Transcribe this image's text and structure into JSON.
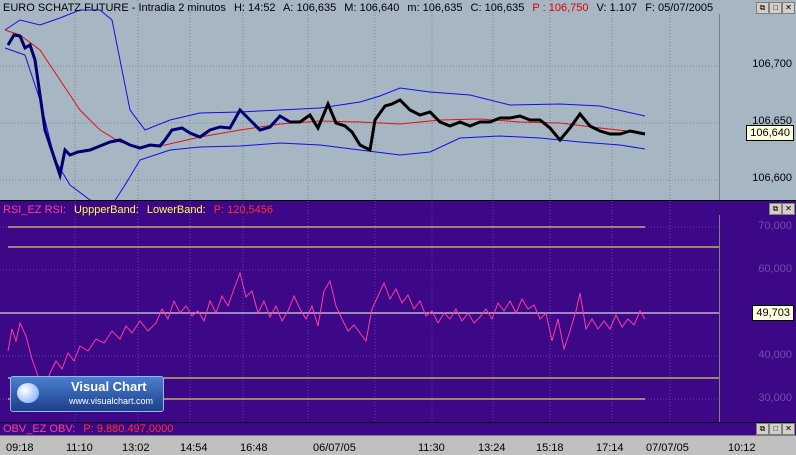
{
  "main": {
    "title": "EURO SCHATZ FUTURE - Intradia 2 minutos",
    "h_label": "H: 14:52",
    "a_label": "A: 106,635",
    "m_label": "M: 106,640",
    "m2_label": "m: 106,635",
    "c_label": "C: 106,635",
    "p_label": "P : 106,750",
    "v_label": "V: 1.107",
    "f_label": "F: 05/07/2005",
    "current_tag": "106,640",
    "y_ticks": [
      "106,700",
      "106,650",
      "106,600"
    ]
  },
  "rsi": {
    "label": "RSI_EZ RSI:",
    "upper_label": "UppperBand:",
    "lower_label": "LowerBand:",
    "p_label": "P: 120,5456",
    "current_tag": "49,703",
    "y_ticks": [
      "70,000",
      "60,000",
      "40,000",
      "30,000"
    ]
  },
  "obv": {
    "label": "OBV_EZ OBV:",
    "p_label": "P: 9.880.497,0000"
  },
  "x_ticks": [
    "09:18",
    "11:10",
    "13:02",
    "14:54",
    "16:48",
    "06/07/05",
    "11:30",
    "13:24",
    "15:18",
    "17:14",
    "07/07/05",
    "10:12"
  ],
  "logo": {
    "name": "Visual Chart",
    "url": "www.visualchart.com"
  },
  "colors": {
    "price_bg": "#a6b6c2",
    "rsi_bg": "#3c0888",
    "rsi_line": "#ff3c9c",
    "band": "#ffff50",
    "bollinger": "#1010e0",
    "ma": "#e81010"
  }
}
